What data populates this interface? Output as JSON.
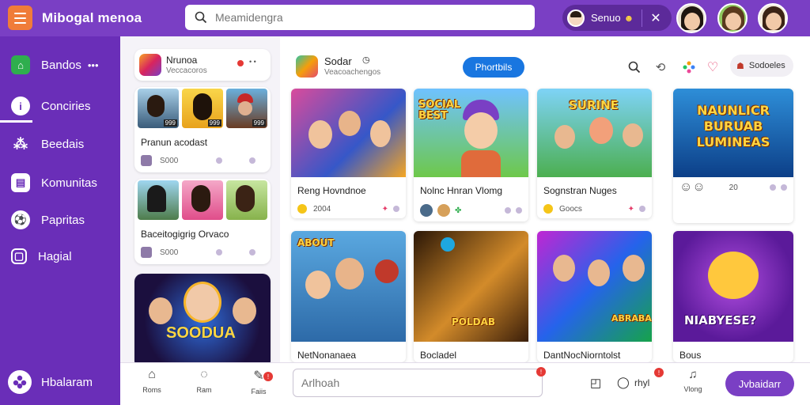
{
  "app": {
    "title": "Mibogal menoa"
  },
  "search": {
    "placeholder": "Meamidengra"
  },
  "user": {
    "name": "Senuo"
  },
  "sidebar": {
    "items": [
      {
        "label": "Bandos",
        "icon": "home-icon",
        "color": "#2fae4e"
      },
      {
        "label": "Conciries",
        "icon": "profile-icon",
        "color": "#ffffff"
      },
      {
        "label": "Beedais",
        "icon": "share-icon",
        "color": "#ffffff"
      },
      {
        "label": "Komunitas",
        "icon": "community-icon",
        "color": "#ffffff"
      },
      {
        "label": "Papritas",
        "icon": "soccer-icon",
        "color": "#ffffff"
      },
      {
        "label": "Hagial",
        "icon": "shop-icon",
        "color": "#ffffff"
      }
    ],
    "more": "•••",
    "bottom_label": "Hbalaram"
  },
  "left_feed": {
    "header": {
      "title": "Nrunoa",
      "subtitle": "Veccacoros"
    },
    "cards": [
      {
        "title": "Pranun acodast",
        "meta": "S000"
      },
      {
        "title": "Baceitogigrig Orvaco",
        "meta": "S000"
      }
    ],
    "thumb_labels": [
      "999",
      "999",
      "999"
    ]
  },
  "main_header": {
    "title": "Sodar",
    "subtitle": "Veacoachengos",
    "follow_label": "Phortbils",
    "subscribe_label": "Sodoeles"
  },
  "games": [
    {
      "title": "Reng Hovndnoe",
      "meta": "2004",
      "banner": ""
    },
    {
      "title": "Nolnc Hnran Vlomg",
      "meta": "",
      "banner": "SOCIAL BEST"
    },
    {
      "title": "Sognstran Nuges",
      "meta": "Goocs",
      "banner": "SURINE"
    },
    {
      "title": "",
      "meta": "20",
      "banner": "NAUNLICR BURUAB LUMINEAS"
    },
    {
      "title": "NetNonanaea",
      "meta": "",
      "banner": "ABOUT"
    },
    {
      "title": "Bocladel",
      "meta": "",
      "banner": "POLDAB"
    },
    {
      "title": "DantNocNiorntolst",
      "meta": "",
      "banner": "ABRABA"
    },
    {
      "title": "Bous",
      "meta": "",
      "banner": "NIABYESE?"
    }
  ],
  "bottom_nav": {
    "items": [
      {
        "label": "Roms"
      },
      {
        "label": "Ram"
      },
      {
        "label": "Faiis"
      }
    ],
    "composer_placeholder": "Arlhoah",
    "chat_label": "rhyl",
    "notify_label": "Vlong",
    "send_label": "Jvbaidarr"
  },
  "colors": {
    "brand_purple": "#7a3fc4",
    "sidebar_purple": "#6a2eb8",
    "accent_orange": "#f07c39",
    "accent_blue": "#1976e0",
    "badge_red": "#e53935"
  }
}
